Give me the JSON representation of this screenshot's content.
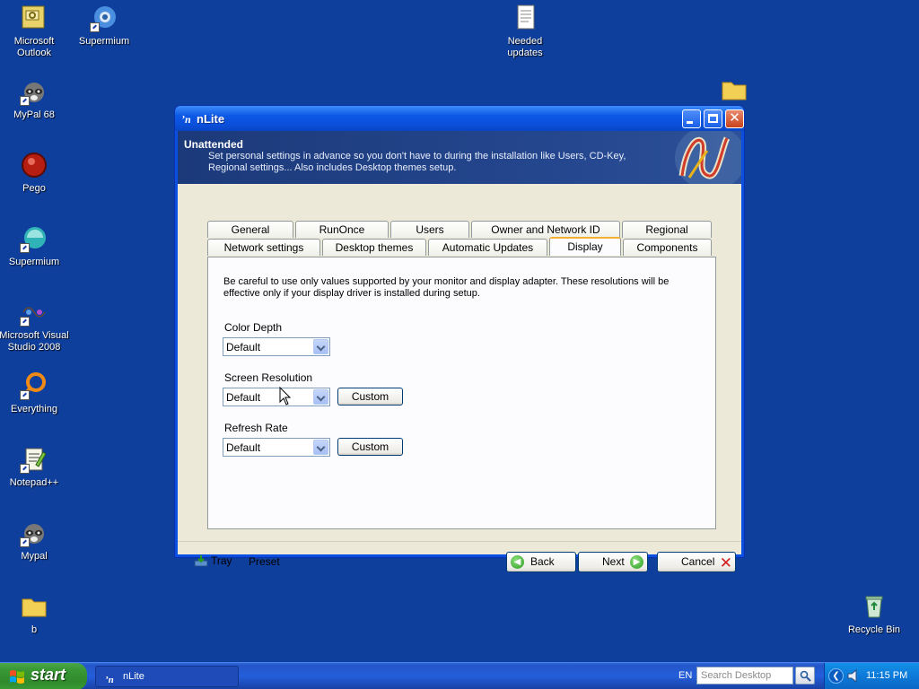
{
  "desktop": {
    "icons": [
      {
        "label": "Microsoft Outlook"
      },
      {
        "label": "Supermium"
      },
      {
        "label": "Needed updates"
      },
      {
        "label": "MyPal 68"
      },
      {
        "label": "Pego"
      },
      {
        "label": "Supermium"
      },
      {
        "label": "Microsoft Visual Studio 2008"
      },
      {
        "label": "Everything"
      },
      {
        "label": "Notepad++"
      },
      {
        "label": "Mypal"
      },
      {
        "label": "b"
      },
      {
        "label": "Recycle Bin"
      }
    ]
  },
  "window": {
    "title": "nLite",
    "header": {
      "title": "Unattended",
      "description": "Set personal settings in advance so you don't have to during the installation like Users, CD-Key, Regional settings... Also includes Desktop themes setup."
    },
    "tabs_row1": [
      "General",
      "RunOnce",
      "Users",
      "Owner and Network ID",
      "Regional"
    ],
    "tabs_row2": [
      "Network settings",
      "Desktop themes",
      "Automatic Updates",
      "Display",
      "Components"
    ],
    "active_tab": "Display",
    "display": {
      "notice": "Be careful to use only values supported by your monitor and display adapter. These resolutions will be effective only if your display driver is installed during setup.",
      "color_depth": {
        "label": "Color Depth",
        "value": "Default"
      },
      "screen_resolution": {
        "label": "Screen Resolution",
        "value": "Default",
        "button": "Custom"
      },
      "refresh_rate": {
        "label": "Refresh Rate",
        "value": "Default",
        "button": "Custom"
      }
    },
    "footer": {
      "tray": "Tray",
      "preset": "Preset",
      "back": "Back",
      "next": "Next",
      "cancel": "Cancel"
    }
  },
  "taskbar": {
    "start": "start",
    "task": "nLite",
    "lang": "EN",
    "search_placeholder": "Search Desktop",
    "clock": "11:15 PM"
  },
  "colors": {
    "desktop": "#0f3f9c",
    "titlebar": "#0c58e6",
    "start_green": "#3b9a37"
  }
}
